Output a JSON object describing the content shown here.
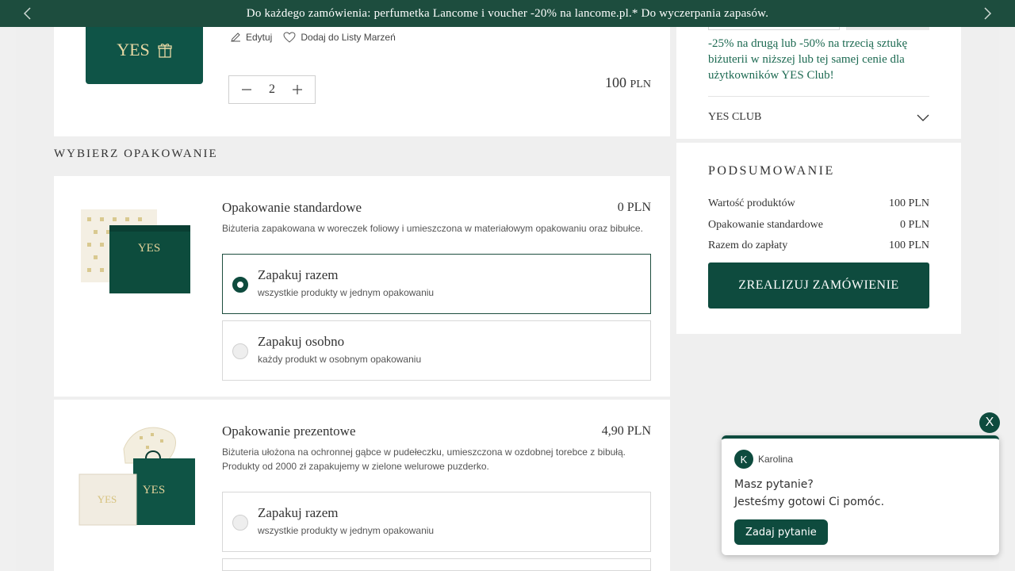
{
  "topbar": {
    "message": "Do każdego zamówienia: perfumetka Lancome i voucher -20% na lancome.pl.* Do wyczerpania zapasów."
  },
  "product": {
    "image_text": "YES",
    "edit_label": "Edytuj",
    "wishlist_label": "Dodaj do Listy Marzeń",
    "quantity": "2",
    "price": "100",
    "currency": "PLN"
  },
  "packaging": {
    "section_title": "WYBIERZ OPAKOWANIE",
    "standard": {
      "title": "Opakowanie standardowe",
      "price": "0 PLN",
      "description": "Biżuteria zapakowana w woreczek foliowy i umieszczona w materiałowym opakowaniu oraz bibułce.",
      "image_text": "YES",
      "options": [
        {
          "title": "Zapakuj razem",
          "subtitle": "wszystkie produkty w jednym opakowaniu",
          "selected": true
        },
        {
          "title": "Zapakuj osobno",
          "subtitle": "każdy produkt w osobnym opakowaniu",
          "selected": false
        }
      ]
    },
    "gift": {
      "title": "Opakowanie prezentowe",
      "price": "4,90 PLN",
      "description_line1": "Biżuteria ułożona na ochronnej gąbce w pudełeczku, umieszczona w ozdobnej torebce z bibułą.",
      "description_line2": "Produkty od 2000 zł zapakujemy w zielone welurowe puzderko.",
      "image_text": "YES",
      "options": [
        {
          "title": "Zapakuj razem",
          "subtitle": "wszystkie produkty w jednym opakowaniu",
          "selected": false
        }
      ]
    }
  },
  "sidebar": {
    "promo": "-25% na drugą lub -50% na trzecią sztukę biżuterii w niższej lub tej samej cenie dla użytkowników YES Club!",
    "yes_club_label": "YES CLUB",
    "summary": {
      "title": "PODSUMOWANIE",
      "rows": [
        {
          "label": "Wartość produktów",
          "value": "100 PLN"
        },
        {
          "label": "Opakowanie standardowe",
          "value": "0 PLN"
        },
        {
          "label": "Razem do zapłaty",
          "value": "100 PLN"
        }
      ],
      "checkout_label": "ZREALIZUJ ZAMÓWIENIE"
    }
  },
  "chat": {
    "close_label": "X",
    "avatar_initial": "K",
    "agent_name": "Karolina",
    "line1": "Masz pytanie?",
    "line2": "Jesteśmy gotowi Ci pomóc.",
    "ask_label": "Zadaj pytanie"
  },
  "colors": {
    "brand_green": "#0e4b3e",
    "topbar_green": "#1d4d3e",
    "promo_green": "#1d6a52"
  }
}
